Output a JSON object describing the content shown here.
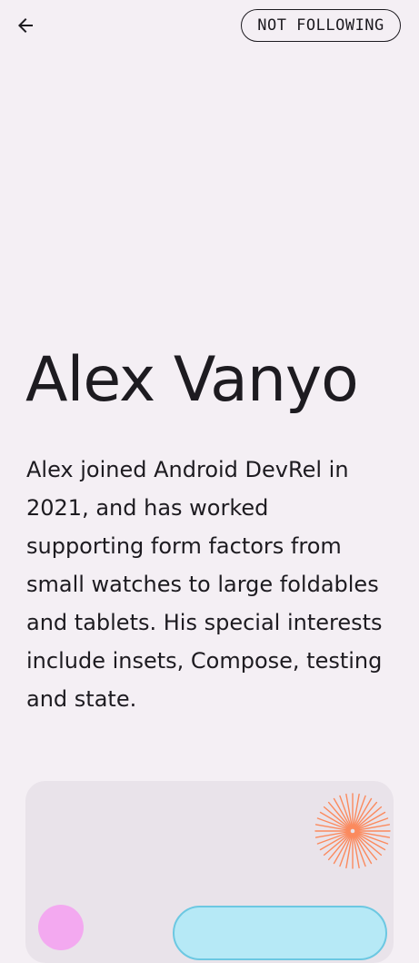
{
  "top_bar": {
    "back_icon": "arrow-back-icon",
    "follow_label": "NOT FOLLOWING"
  },
  "author": {
    "name": "Alex Vanyo",
    "bio": "Alex joined Android DevRel in 2021, and has worked supporting form factors from small watches to large foldables and tablets. His special interests include insets, Compose, testing and state."
  },
  "colors": {
    "background": "#f4eff4",
    "text": "#1d1b20",
    "card": "#e9e3ea",
    "burst": "#fb8a5e",
    "avatar_accent": "#f3a9f0",
    "pill_accent": "#b6e9f6"
  },
  "card": {
    "decoration_icon": "starburst-icon"
  }
}
